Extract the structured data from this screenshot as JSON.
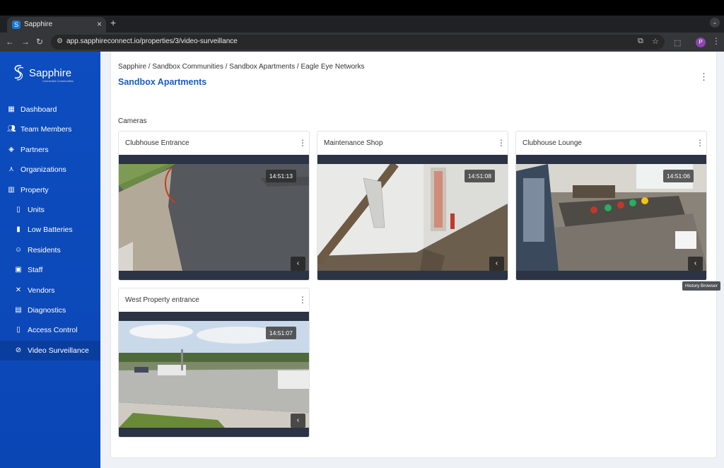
{
  "browser": {
    "tab_title": "Sapphire",
    "url": "app.sapphireconnect.io/properties/3/video-surveillance",
    "profile_initial": "P"
  },
  "brand": {
    "name": "Sapphire",
    "tagline": "Connected Communities"
  },
  "sidebar": {
    "items": [
      {
        "label": "Dashboard",
        "icon": "dashboard-icon"
      },
      {
        "label": "Team Members",
        "icon": "team-icon"
      },
      {
        "label": "Partners",
        "icon": "handshake-icon"
      },
      {
        "label": "Organizations",
        "icon": "org-tree-icon"
      },
      {
        "label": "Property",
        "icon": "building-icon"
      },
      {
        "label": "Units",
        "icon": "door-icon"
      },
      {
        "label": "Low Batteries",
        "icon": "battery-icon"
      },
      {
        "label": "Residents",
        "icon": "residents-icon"
      },
      {
        "label": "Staff",
        "icon": "badge-icon"
      },
      {
        "label": "Vendors",
        "icon": "tools-icon"
      },
      {
        "label": "Diagnostics",
        "icon": "diagnostics-icon"
      },
      {
        "label": "Access Control",
        "icon": "access-door-icon"
      },
      {
        "label": "Video Surveillance",
        "icon": "cctv-icon"
      }
    ]
  },
  "page": {
    "breadcrumb": "Sapphire / Sandbox Communities / Sandbox Apartments / Eagle Eye Networks",
    "title": "Sandbox Apartments",
    "section": "Cameras"
  },
  "cameras": [
    {
      "name": "Clubhouse Entrance",
      "timestamp": "14:51:13"
    },
    {
      "name": "Maintenance Shop",
      "timestamp": "14:51:08"
    },
    {
      "name": "Clubhouse Lounge",
      "timestamp": "14:51:06"
    },
    {
      "name": "West Property entrance",
      "timestamp": "14:51:07"
    }
  ],
  "tooltip": "History Browser",
  "colors": {
    "sidebar": "#0b46b5",
    "accent": "#1a5bc4"
  }
}
